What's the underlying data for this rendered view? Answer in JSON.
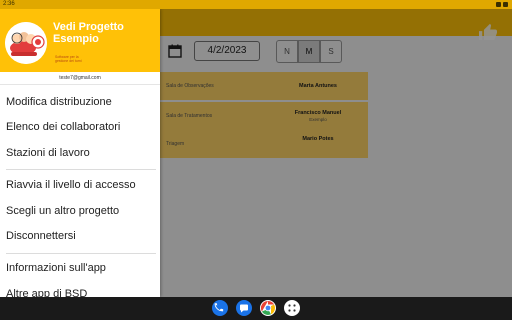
{
  "status_bar": {
    "time": "2:36"
  },
  "drawer": {
    "project_title_line1": "Vedi Progetto",
    "project_title_line2": "Esempio",
    "tagline_line1": "Software per la",
    "tagline_line2": "gestione dei turni",
    "email": "teste7@gmail.com",
    "items": [
      {
        "label": "Modifica distribuzione"
      },
      {
        "label": "Elenco dei collaboratori"
      },
      {
        "label": "Stazioni di lavoro"
      },
      {
        "label": "Riavvia il livello di accesso"
      },
      {
        "label": "Scegli un altro progetto"
      },
      {
        "label": "Disconnettersi"
      },
      {
        "label": "Informazioni sull'app"
      },
      {
        "label": "Altre app di BSD"
      }
    ]
  },
  "toolbar": {
    "date": "4/2/2023",
    "shifts": [
      "N",
      "M",
      "S"
    ],
    "selected_shift": "M"
  },
  "schedule": [
    {
      "room": "Sala de Observações",
      "person": "Marta Antunes",
      "sub": ""
    },
    {
      "room": "Sala de Tratamentos",
      "person": "Francisco Manuel",
      "sub": "Exemplo"
    },
    {
      "room": "Triagem",
      "person": "Mario Potes",
      "sub": ""
    }
  ],
  "colors": {
    "accent": "#ffc107",
    "status_bar": "#e0a800",
    "room_card": "#ffd466",
    "nav_bar": "#1a1a1a"
  },
  "nav_apps": [
    "phone-icon",
    "messages-icon",
    "chrome-icon",
    "app-drawer-icon"
  ]
}
